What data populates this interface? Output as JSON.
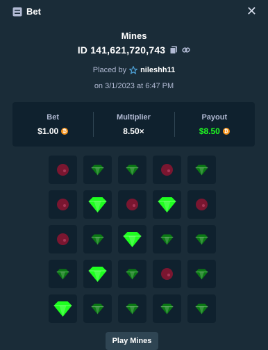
{
  "header": {
    "title": "Bet",
    "close_glyph": "✕"
  },
  "game": {
    "name": "Mines",
    "id_text": "ID 141,621,720,743",
    "placed_by_label": "Placed by",
    "username": "nileshh11",
    "date_text": "on 3/1/2023 at 6:47 PM"
  },
  "stats": {
    "bet_label": "Bet",
    "bet_value": "$1.00",
    "multiplier_label": "Multiplier",
    "multiplier_value": "8.50×",
    "payout_label": "Payout",
    "payout_value": "$8.50",
    "currency_icon": "bitcoin-coin-icon"
  },
  "board": {
    "rows": [
      [
        "mine",
        "gem",
        "gem",
        "mine",
        "gem"
      ],
      [
        "mine",
        "gem-revealed",
        "mine",
        "gem-revealed",
        "mine"
      ],
      [
        "mine",
        "gem",
        "gem-revealed",
        "gem",
        "gem"
      ],
      [
        "gem",
        "gem-revealed",
        "gem",
        "mine",
        "gem"
      ],
      [
        "gem-revealed",
        "gem",
        "gem",
        "gem",
        "gem"
      ]
    ]
  },
  "colors": {
    "background": "#1a2c38",
    "panel": "#0f212e",
    "payout_green": "#1fff20",
    "gem_revealed": "#1fff20",
    "gem_dim": "#0b7a14",
    "mine": "#7a1630"
  },
  "footer": {
    "play_button_label": "Play Mines"
  }
}
